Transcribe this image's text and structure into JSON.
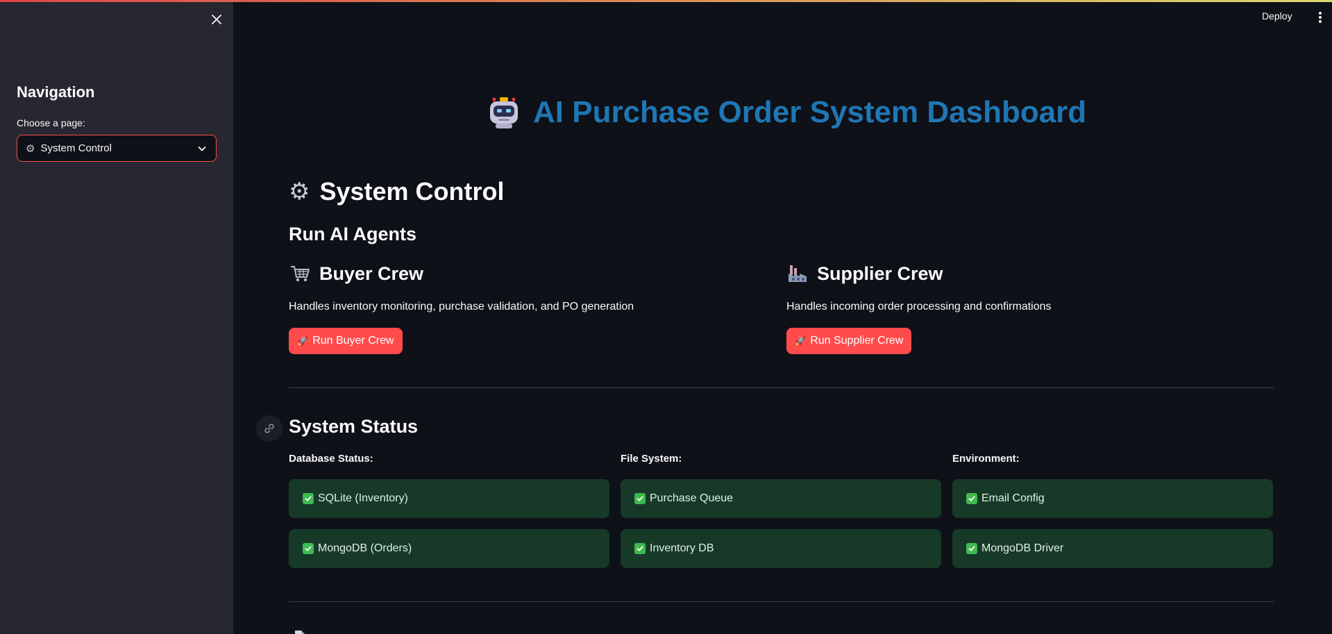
{
  "sidebar": {
    "title": "Navigation",
    "select_label": "Choose a page:",
    "select_value": "System Control",
    "select_icon": "gear-icon"
  },
  "header": {
    "deploy_label": "Deploy"
  },
  "main": {
    "title": "AI Purchase Order System Dashboard",
    "title_icon": "robot-icon",
    "section_title": "System Control",
    "section_icon": "gear-icon",
    "run_agents_title": "Run AI Agents",
    "buyer": {
      "title": "Buyer Crew",
      "icon": "shopping-cart-icon",
      "description": "Handles inventory monitoring, purchase validation, and PO generation",
      "button_label": "Run Buyer Crew"
    },
    "supplier": {
      "title": "Supplier Crew",
      "icon": "factory-icon",
      "description": "Handles incoming order processing and confirmations",
      "button_label": "Run Supplier Crew"
    },
    "status": {
      "title": "System Status",
      "columns": [
        {
          "label": "Database Status:",
          "items": [
            "SQLite (Inventory)",
            "MongoDB (Orders)"
          ]
        },
        {
          "label": "File System:",
          "items": [
            "Purchase Queue",
            "Inventory DB"
          ]
        },
        {
          "label": "Environment:",
          "items": [
            "Email Config",
            "MongoDB Driver"
          ]
        }
      ]
    }
  },
  "colors": {
    "accent": "#ff4b4b",
    "title_blue": "#1f77b4",
    "success_bg": "#173928",
    "check_green": "#3fb950",
    "background": "#0e1117",
    "sidebar_bg": "#262730"
  }
}
